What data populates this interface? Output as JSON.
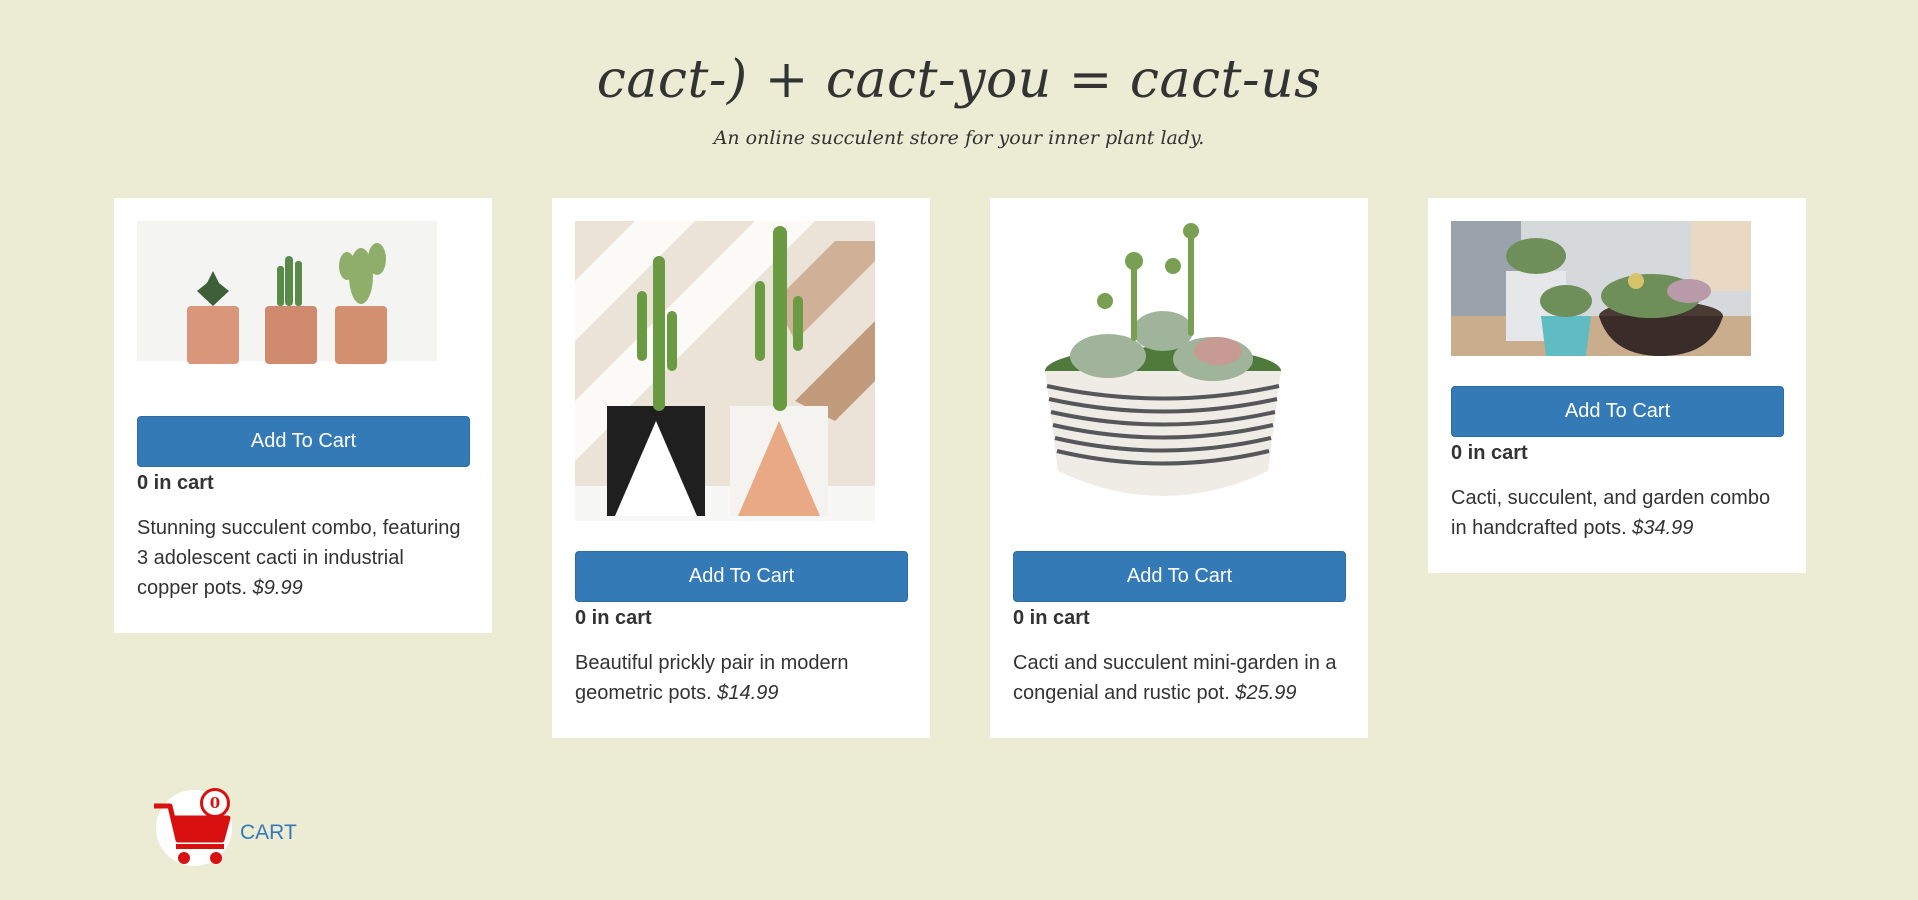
{
  "header": {
    "title": "cact-) + cact-you = cact-us",
    "subtitle": "An online succulent store for your inner plant lady."
  },
  "products": [
    {
      "image_alt": "three small cacti in copper pots",
      "button_label": "Add To Cart",
      "count_label": "0 in cart",
      "description": "Stunning succulent combo, featuring 3 adolescent cacti in industrial copper pots.",
      "price": "$9.99"
    },
    {
      "image_alt": "two tall cacti in geometric pots",
      "button_label": "Add To Cart",
      "count_label": "0 in cart",
      "description": "Beautiful prickly pair in modern geometric pots.",
      "price": "$14.99"
    },
    {
      "image_alt": "succulent mini-garden in rustic striped bowl",
      "button_label": "Add To Cart",
      "count_label": "0 in cart",
      "description": "Cacti and succulent mini-garden in a congenial and rustic pot.",
      "price": "$25.99"
    },
    {
      "image_alt": "succulent combos in handcrafted pots on table",
      "button_label": "Add To Cart",
      "count_label": "0 in cart",
      "description": "Cacti, succulent, and garden combo in handcrafted pots.",
      "price": "$34.99"
    }
  ],
  "cart": {
    "count": "0",
    "label": "CART"
  },
  "colors": {
    "background": "#ebecd3",
    "card": "#ffffff",
    "button": "#337ab7",
    "cart_icon": "#d81010",
    "link": "#337ab7"
  }
}
